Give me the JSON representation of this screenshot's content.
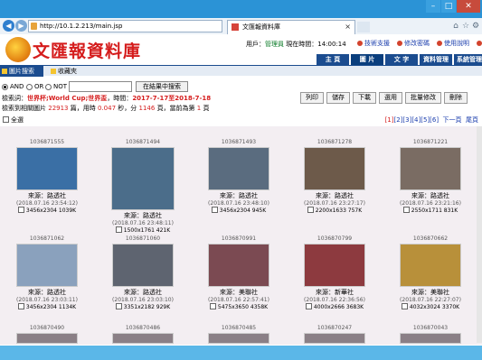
{
  "browser": {
    "url": "http://10.1.2.213/main.jsp",
    "tab_title": "文匯報資料庫"
  },
  "header": {
    "logo_text": "文匯報資料庫",
    "user_label": "用戶：",
    "user_name": "管理員",
    "time_label": "現在時間：",
    "time_value": "14:00:14",
    "links": [
      "技術支援",
      "修改密碼",
      "使用說明",
      "退出"
    ],
    "nav_tabs": [
      "主 頁",
      "圖 片",
      "文 字",
      "資料管理",
      "系統管理"
    ]
  },
  "subtabs": {
    "selected": "圖片搜索",
    "other": "收藏夾"
  },
  "search": {
    "options": [
      "AND",
      "OR",
      "NOT"
    ],
    "button": "在結果中搜索",
    "query_label": "檢索詞：",
    "query_text": "世界杯;World Cup;世界盃",
    "date_label": "，時間：",
    "date_text": "2017-7-17至2018-7-18",
    "result_prefix": "檢索到相關圖片",
    "result_count": "22913",
    "result_mid": "篇，用時",
    "result_time": "0.047",
    "result_sec": "秒，分",
    "result_pages": "1146",
    "result_page_mid": "頁，當前為第",
    "result_cur": "1",
    "result_end": "頁"
  },
  "actions": [
    "列印",
    "儲存",
    "下載",
    "選用",
    "批量修改",
    "刪除"
  ],
  "select_all": "全選",
  "pager": {
    "pages": [
      "[1]",
      "[2]",
      "[3]",
      "[4]",
      "[5]",
      "[6]"
    ],
    "next": "下一頁",
    "last": "尾頁"
  },
  "cards": [
    {
      "id": "1036871555",
      "src": "來源：路透社",
      "dt": "(2018.07.16 23:54:12)",
      "dim": "3456x2304 1039K",
      "color": "#3a6fa5"
    },
    {
      "id": "1036871494",
      "src": "來源：路透社",
      "dt": "(2018.07.16 23:48:11)",
      "dim": "1500x1761 421K",
      "color": "#4b6d8a"
    },
    {
      "id": "1036871493",
      "src": "來源：路透社",
      "dt": "(2018.07.16 23:48:10)",
      "dim": "3456x2304 945K",
      "color": "#5a6c7f"
    },
    {
      "id": "1036871278",
      "src": "來源：路透社",
      "dt": "(2018.07.16 23:27:17)",
      "dim": "2200x1633 757K",
      "color": "#6d5a4a"
    },
    {
      "id": "1036871221",
      "src": "來源：路透社",
      "dt": "(2018.07.16 23:21:16)",
      "dim": "2550x1711 831K",
      "color": "#7a6c63"
    },
    {
      "id": "1036871062",
      "src": "來源：路透社",
      "dt": "(2018.07.16 23:03:11)",
      "dim": "3456x2304 1134K",
      "color": "#8aa1bd"
    },
    {
      "id": "1036871060",
      "src": "來源：路透社",
      "dt": "(2018.07.16 23:03:10)",
      "dim": "3351x2182 929K",
      "color": "#5e6470"
    },
    {
      "id": "1036870991",
      "src": "來源：美聯社",
      "dt": "(2018.07.16 22:57:41)",
      "dim": "5475x3650 4358K",
      "color": "#7b4a52"
    },
    {
      "id": "1036870799",
      "src": "來源：新華社",
      "dt": "(2018.07.16 22:36:56)",
      "dim": "4000x2666 3683K",
      "color": "#8d3a3f"
    },
    {
      "id": "1036870662",
      "src": "來源：美聯社",
      "dt": "(2018.07.16 22:27:07)",
      "dim": "4032x3024 3370K",
      "color": "#b8903a"
    }
  ],
  "row3_ids": [
    "1036870490",
    "1036870486",
    "1036870485",
    "1036870247",
    "1036870043"
  ]
}
